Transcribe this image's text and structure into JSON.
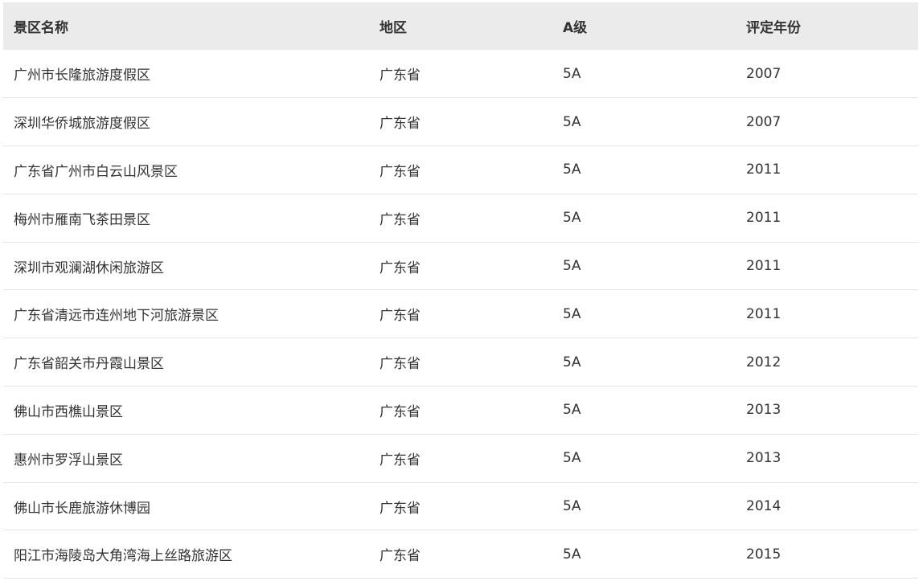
{
  "table": {
    "headers": [
      "景区名称",
      "地区",
      "A级",
      "评定年份"
    ],
    "rows": [
      [
        "广州市长隆旅游度假区",
        "广东省",
        "5A",
        "2007"
      ],
      [
        "深圳华侨城旅游度假区",
        "广东省",
        "5A",
        "2007"
      ],
      [
        "广东省广州市白云山风景区",
        "广东省",
        "5A",
        "2011"
      ],
      [
        "梅州市雁南飞茶田景区",
        "广东省",
        "5A",
        "2011"
      ],
      [
        "深圳市观澜湖休闲旅游区",
        "广东省",
        "5A",
        "2011"
      ],
      [
        "广东省清远市连州地下河旅游景区",
        "广东省",
        "5A",
        "2011"
      ],
      [
        "广东省韶关市丹霞山景区",
        "广东省",
        "5A",
        "2012"
      ],
      [
        "佛山市西樵山景区",
        "广东省",
        "5A",
        "2013"
      ],
      [
        "惠州市罗浮山景区",
        "广东省",
        "5A",
        "2013"
      ],
      [
        "佛山市长鹿旅游休博园",
        "广东省",
        "5A",
        "2014"
      ],
      [
        "阳江市海陵岛大角湾海上丝路旅游区",
        "广东省",
        "5A",
        "2015"
      ]
    ]
  }
}
